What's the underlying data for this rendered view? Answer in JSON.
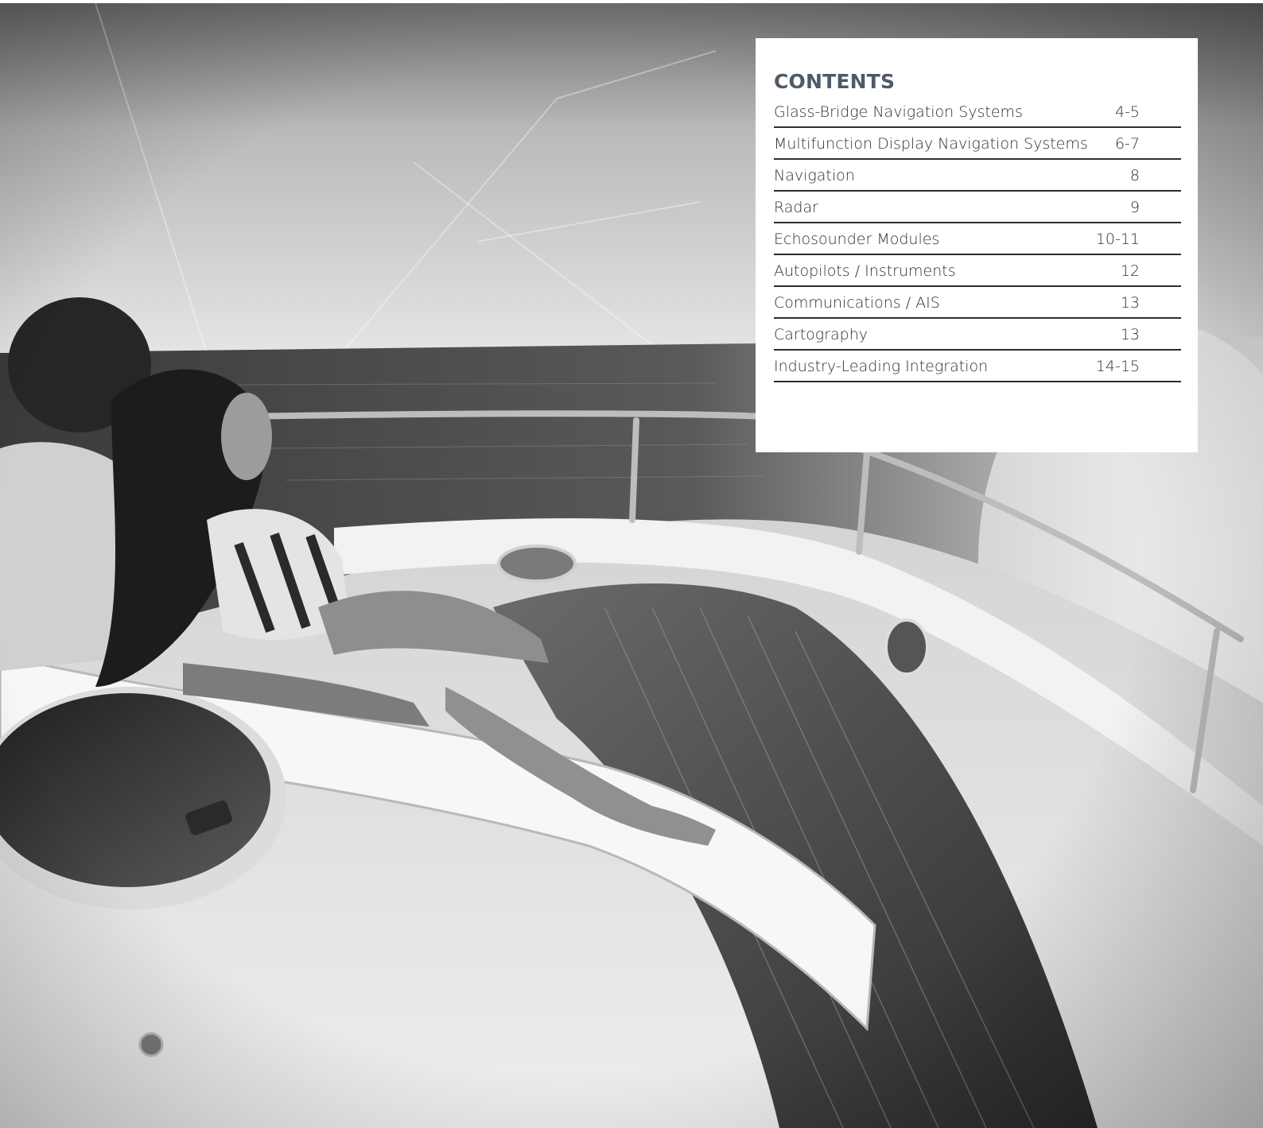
{
  "contents": {
    "heading": "CONTENTS",
    "items": [
      {
        "title": "Glass-Bridge Navigation Systems",
        "pages": "4-5"
      },
      {
        "title": "Multifunction Display Navigation Systems",
        "pages": "6-7"
      },
      {
        "title": "Navigation",
        "pages": "8"
      },
      {
        "title": "Radar",
        "pages": "9"
      },
      {
        "title": "Echosounder Modules",
        "pages": "10-11"
      },
      {
        "title": "Autopilots / Instruments",
        "pages": "12"
      },
      {
        "title": "Communications / AIS",
        "pages": "13"
      },
      {
        "title": "Cartography",
        "pages": "13"
      },
      {
        "title": "Industry-Leading Integration",
        "pages": "14-15"
      }
    ]
  },
  "photo": {
    "description_icon": "yacht-bow-photo",
    "tone": "grayscale"
  }
}
